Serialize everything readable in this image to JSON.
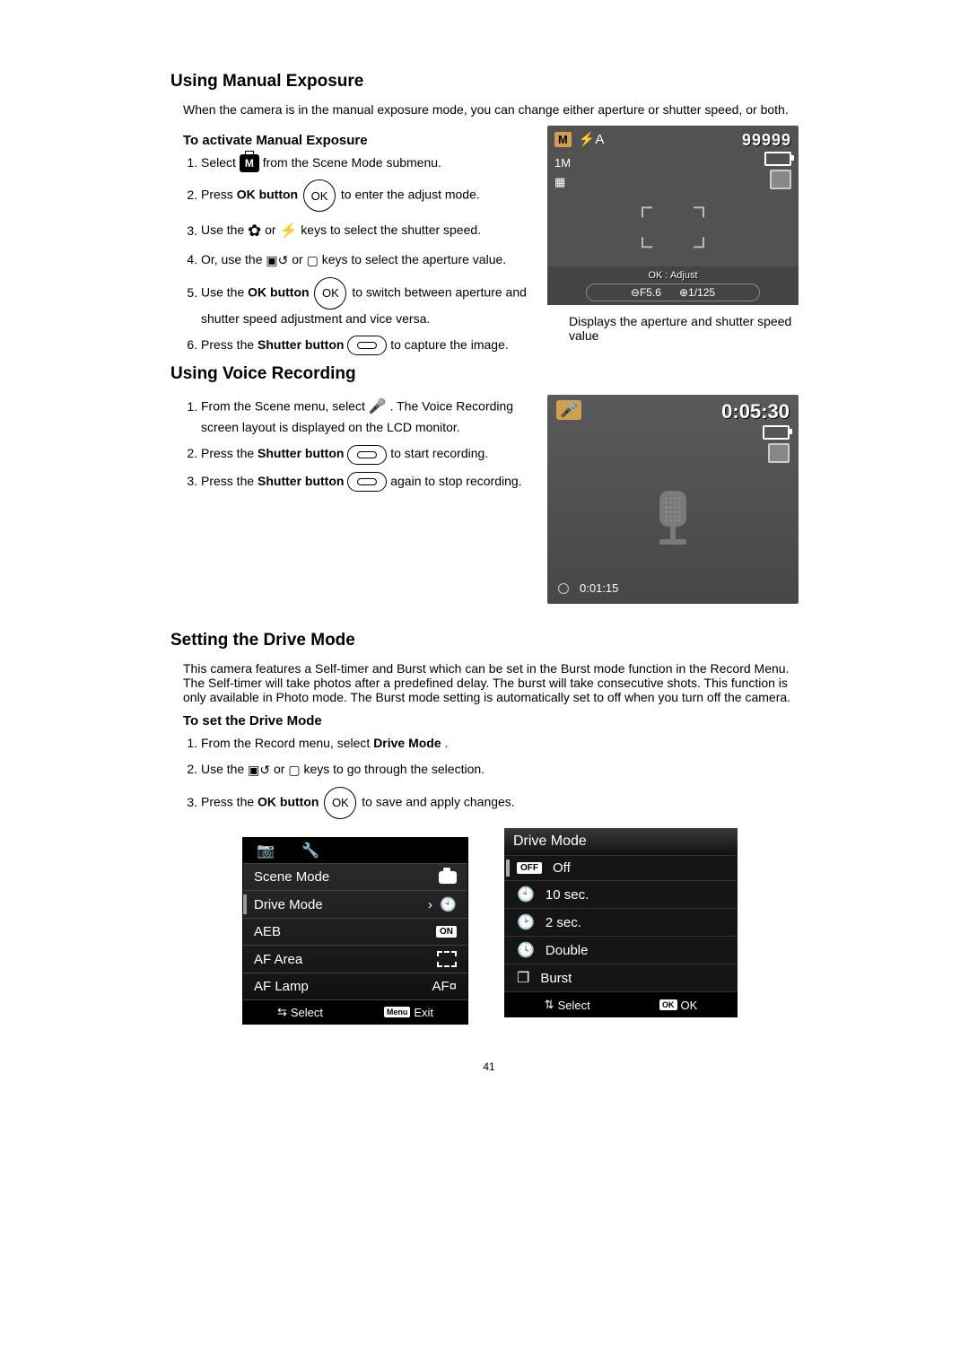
{
  "pageNumber": "41",
  "s1": {
    "heading": "Using Manual Exposure",
    "intro": "When the camera is in the manual exposure mode, you can change either aperture or shutter speed, or both.",
    "subheading": "To activate Manual Exposure",
    "steps": {
      "i1a": "Select ",
      "i1b": " from the Scene Mode submenu.",
      "i2a": "Press ",
      "i2b": "OK button",
      "i2c": " to enter the adjust mode.",
      "i3a": "Use the ",
      "i3b": " or ",
      "i3c": " keys to select the shutter speed.",
      "i4a": "Or, use the ",
      "i4b": " or ",
      "i4c": " keys to select the aperture value.",
      "i5a": "Use the ",
      "i5b": "OK button",
      "i5c": " to switch between aperture and shutter speed adjustment and vice versa.",
      "i6a": "Press the ",
      "i6b": "Shutter button",
      "i6c": " to capture the image."
    },
    "lcd": {
      "mode": "M",
      "flash": "⚡A",
      "shots": "99999",
      "res": "1M",
      "okHint": "OK : Adjust",
      "aperture": "⊖F5.6",
      "shutter": "⊕1/125"
    },
    "caption": "Displays the aperture and shutter speed value"
  },
  "s2": {
    "heading": "Using Voice Recording",
    "steps": {
      "i1a": "From the Scene menu, select ",
      "i1b": ". The Voice Recording screen layout is displayed on the LCD monitor.",
      "i2a": "Press the ",
      "i2b": "Shutter button",
      "i2c": " to start recording.",
      "i3a": "Press the ",
      "i3b": "Shutter button",
      "i3c": " again to stop recording."
    },
    "lcd": {
      "elapsed": "0:05:30",
      "clip": "0:01:15"
    }
  },
  "s3": {
    "heading": "Setting the Drive Mode",
    "intro": "This camera features a Self-timer and Burst which can be set in the Burst mode function in the Record Menu. The Self-timer will take photos after a predefined delay. The burst will take consecutive shots. This function is only available in Photo mode. The Burst mode setting is automatically set to off when you turn off the camera.",
    "subheading": "To set the Drive Mode",
    "steps": {
      "i1a": "From the Record menu, select ",
      "i1b": "Drive Mode",
      "i1c": ".",
      "i2a": "Use the ",
      "i2b": " or ",
      "i2c": " keys to go through the selection.",
      "i3a": "Press the ",
      "i3b": "OK button",
      "i3c": " to save and apply changes."
    },
    "recordMenu": {
      "row1": "Scene Mode",
      "row2": "Drive Mode",
      "row3": "AEB",
      "row4": "AF Area",
      "row5": "AF Lamp",
      "val3": "ON",
      "val5": "AF¤",
      "footerSelect": "Select",
      "footerExit": "Exit",
      "menuLabel": "Menu"
    },
    "driveMenu": {
      "title": "Drive Mode",
      "o1": "Off",
      "o2": "10 sec.",
      "o3": "2 sec.",
      "o4": "Double",
      "o5": "Burst",
      "offBadge": "OFF",
      "footerSelect": "Select",
      "footerOk": "OK",
      "okBadge": "OK"
    }
  },
  "iconText": {
    "ok": "OK",
    "m": "M"
  }
}
